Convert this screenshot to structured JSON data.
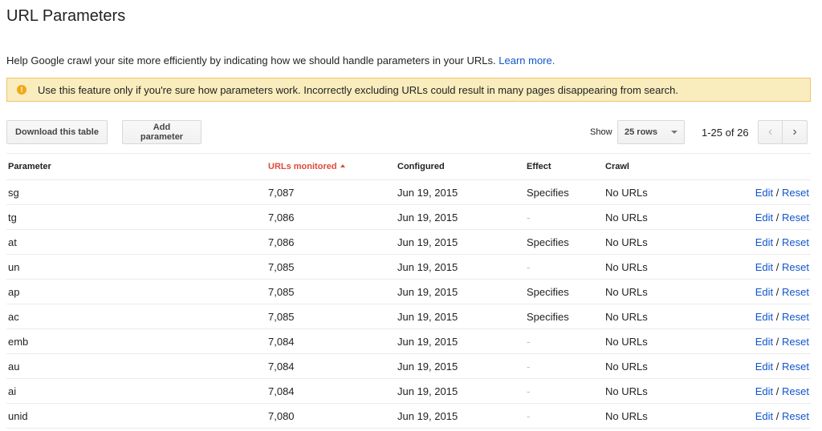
{
  "header": {
    "title": "URL Parameters"
  },
  "intro": {
    "text": "Help Google crawl your site more efficiently by indicating how we should handle parameters in your URLs.",
    "link": "Learn more."
  },
  "warning": {
    "icon": "!",
    "text": "Use this feature only if you're sure how parameters work. Incorrectly excluding URLs could result in many pages disappearing from search."
  },
  "toolbar": {
    "download_label": "Download this table",
    "add_label": "Add parameter"
  },
  "pager": {
    "show_label": "Show",
    "rows_value": "25 rows",
    "range": "1-25 of 26",
    "prev": "‹",
    "next": "›"
  },
  "table": {
    "columns": [
      "Parameter",
      "URLs monitored",
      "Configured",
      "Effect",
      "Crawl"
    ],
    "action_edit": "Edit",
    "action_sep": "/",
    "action_reset": "Reset",
    "rows": [
      {
        "parameter": "sg",
        "monitored": "7,087",
        "configured": "Jun 19, 2015",
        "effect": "Specifies",
        "crawl": "No URLs"
      },
      {
        "parameter": "tg",
        "monitored": "7,086",
        "configured": "Jun 19, 2015",
        "effect": "-",
        "crawl": "No URLs"
      },
      {
        "parameter": "at",
        "monitored": "7,086",
        "configured": "Jun 19, 2015",
        "effect": "Specifies",
        "crawl": "No URLs"
      },
      {
        "parameter": "un",
        "monitored": "7,085",
        "configured": "Jun 19, 2015",
        "effect": "-",
        "crawl": "No URLs"
      },
      {
        "parameter": "ap",
        "monitored": "7,085",
        "configured": "Jun 19, 2015",
        "effect": "Specifies",
        "crawl": "No URLs"
      },
      {
        "parameter": "ac",
        "monitored": "7,085",
        "configured": "Jun 19, 2015",
        "effect": "Specifies",
        "crawl": "No URLs"
      },
      {
        "parameter": "emb",
        "monitored": "7,084",
        "configured": "Jun 19, 2015",
        "effect": "-",
        "crawl": "No URLs"
      },
      {
        "parameter": "au",
        "monitored": "7,084",
        "configured": "Jun 19, 2015",
        "effect": "-",
        "crawl": "No URLs"
      },
      {
        "parameter": "ai",
        "monitored": "7,084",
        "configured": "Jun 19, 2015",
        "effect": "-",
        "crawl": "No URLs"
      },
      {
        "parameter": "unid",
        "monitored": "7,080",
        "configured": "Jun 19, 2015",
        "effect": "-",
        "crawl": "No URLs"
      }
    ]
  }
}
